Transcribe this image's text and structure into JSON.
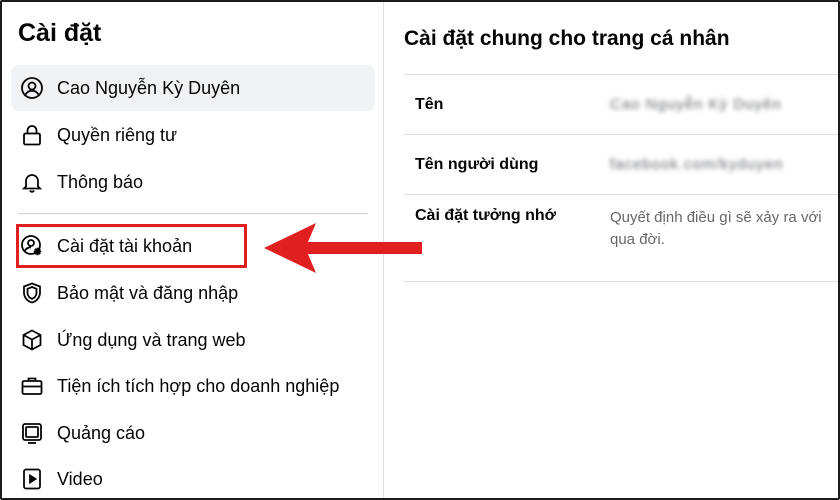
{
  "sidebar": {
    "title": "Cài đặt",
    "items": [
      {
        "label": "Cao Nguyễn Kỳ Duyên",
        "icon": "user-circle-icon"
      },
      {
        "label": "Quyền riêng tư",
        "icon": "lock-icon"
      },
      {
        "label": "Thông báo",
        "icon": "bell-icon"
      },
      {
        "label": "Cài đặt tài khoản",
        "icon": "user-gear-icon"
      },
      {
        "label": "Bảo mật và đăng nhập",
        "icon": "shield-icon"
      },
      {
        "label": "Ứng dụng và trang web",
        "icon": "cube-icon"
      },
      {
        "label": "Tiện ích tích hợp cho doanh nghiệp",
        "icon": "briefcase-icon"
      },
      {
        "label": "Quảng cáo",
        "icon": "monitor-icon"
      },
      {
        "label": "Video",
        "icon": "video-icon"
      }
    ]
  },
  "main": {
    "title": "Cài đặt chung cho trang cá nhân",
    "rows": [
      {
        "label": "Tên",
        "value": "Cao Nguyễn Kỳ Duyên"
      },
      {
        "label": "Tên người dùng",
        "value": "facebook.com/kyduyen"
      },
      {
        "label": "Cài đặt tưởng nhớ",
        "value_line1": "Quyết định điều gì sẽ xảy ra với",
        "value_line2": "qua đời."
      }
    ]
  },
  "annotation": {
    "highlight_color": "#e02020"
  }
}
